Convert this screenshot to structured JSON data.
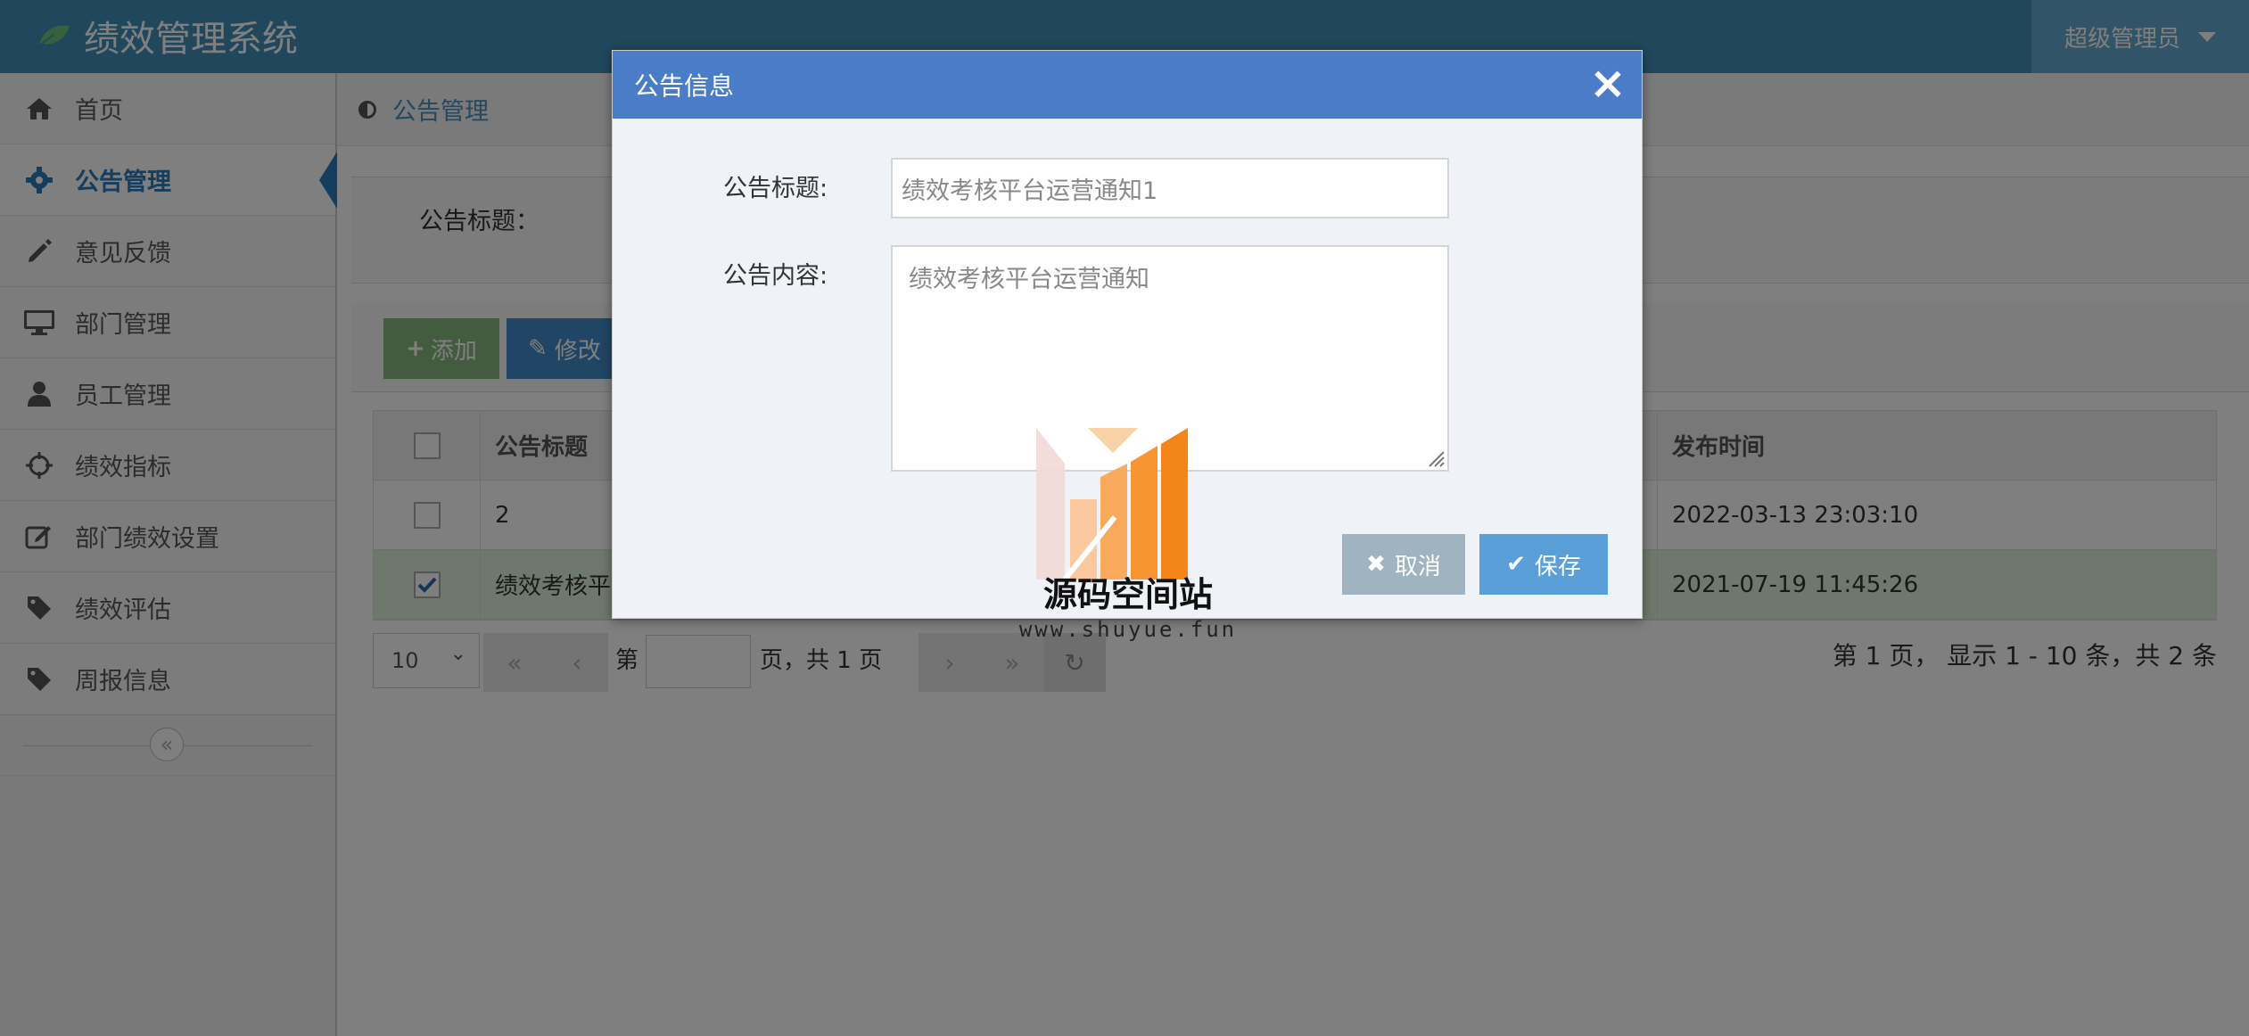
{
  "app": {
    "title": "绩效管理系统",
    "user": "超级管理员"
  },
  "sidebar": {
    "items": [
      {
        "label": "首页",
        "icon": "home-icon"
      },
      {
        "label": "公告管理",
        "icon": "gear-icon",
        "active": true
      },
      {
        "label": "意见反馈",
        "icon": "pencil-icon"
      },
      {
        "label": "部门管理",
        "icon": "desktop-icon"
      },
      {
        "label": "员工管理",
        "icon": "user-icon"
      },
      {
        "label": "绩效指标",
        "icon": "crosshairs-icon"
      },
      {
        "label": "部门绩效设置",
        "icon": "edit-icon"
      },
      {
        "label": "绩效评估",
        "icon": "tag-icon"
      },
      {
        "label": "周报信息",
        "icon": "tag-icon"
      }
    ]
  },
  "breadcrumb": {
    "current": "公告管理"
  },
  "search": {
    "label": "公告标题："
  },
  "toolbar": {
    "add_label": "添加",
    "edit_label": "修改"
  },
  "table": {
    "headers": {
      "title": "公告标题",
      "time": "发布时间"
    },
    "rows": [
      {
        "title": "2",
        "time": "2022-03-13 23:03:10",
        "checked": false
      },
      {
        "title": "绩效考核平",
        "time": "2021-07-19 11:45:26",
        "checked": true
      }
    ]
  },
  "pager": {
    "page_size": "10",
    "prefix": "第",
    "suffix": "页，共 1 页",
    "info": "第 1 页， 显示 1 - 10 条，共 2 条"
  },
  "modal": {
    "title": "公告信息",
    "title_label": "公告标题:",
    "title_value": "绩效考核平台运营通知1",
    "content_label": "公告内容:",
    "content_value": "绩效考核平台运营通知",
    "cancel_label": "取消",
    "save_label": "保存"
  },
  "watermark": {
    "name": "源码空间站",
    "url": "www.shuyue.fun"
  },
  "colors": {
    "navbar": "#438eb9",
    "modal_header": "#4a7cc7",
    "accent": "#2b7dbc",
    "add": "#87b87f",
    "selected_row": "#dff0d8"
  }
}
